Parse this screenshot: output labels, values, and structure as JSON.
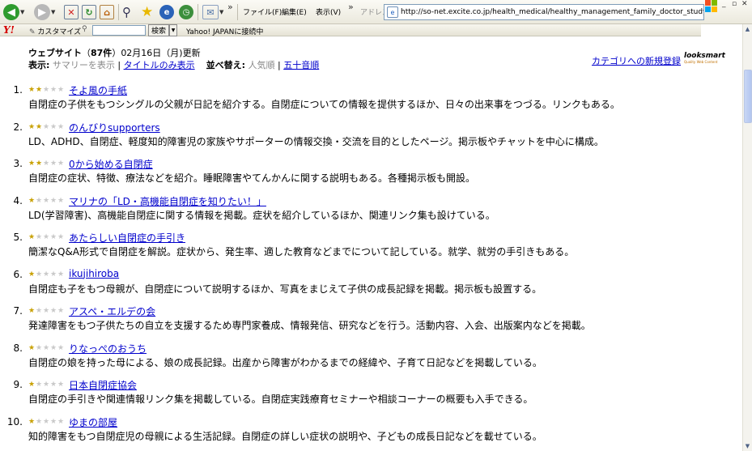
{
  "toolbar": {
    "menus": [
      "ファイル(F)",
      "編集(E)",
      "表示(V)"
    ],
    "address_label": "アドレス",
    "url": "http://so-net.excite.co.jp/health_medical/healthy_management_family_doctor_study/chik"
  },
  "yahoo_bar": {
    "logo": "Y!",
    "customize": "カスタマイズ",
    "search_button": "検索",
    "status": "Yahoo! JAPANに接続中"
  },
  "header": {
    "section": "ウェブサイト",
    "count": "87件",
    "updated": "02月16日（月)更新",
    "display_label": "表示:",
    "display_summary": "サマリーを表示",
    "display_title_only": "タイトルのみ表示",
    "sort_label": "並べ替え:",
    "sort_popular": "人気順",
    "sort_alpha": "五十音順",
    "new_category_link": "カテゴリへの新規登録",
    "logo_main": "looksmart",
    "logo_sub": "Quality Web Content"
  },
  "results": [
    {
      "num": "1.",
      "stars": 2,
      "title": "そよ風の手紙",
      "desc": "自閉症の子供をもつシングルの父親が日記を紹介する。自閉症についての情報を提供するほか、日々の出来事をつづる。リンクもある。"
    },
    {
      "num": "2.",
      "stars": 2,
      "title": "のんびりsupporters",
      "desc": "LD、ADHD、自閉症、軽度知的障害児の家族やサポーターの情報交換・交流を目的としたページ。掲示板やチャットを中心に構成。"
    },
    {
      "num": "3.",
      "stars": 2,
      "title": "0から始める自閉症",
      "desc": "自閉症の症状、特徴、療法などを紹介。睡眠障害やてんかんに関する説明もある。各種掲示板も開設。"
    },
    {
      "num": "4.",
      "stars": 1,
      "title": "マリナの「LD・高機能自閉症を知りたい！」",
      "desc": "LD(学習障害)、高機能自閉症に関する情報を掲載。症状を紹介しているほか、関連リンク集も設けている。"
    },
    {
      "num": "5.",
      "stars": 1,
      "title": "あたらしい自閉症の手引き",
      "desc": "簡潔なQ&A形式で自閉症を解説。症状から、発生率、適した教育などまでについて記している。就学、就労の手引きもある。"
    },
    {
      "num": "6.",
      "stars": 1,
      "title": "ikujihiroba",
      "desc": "自閉症も子をもつ母親が、自閉症について説明するほか、写真をまじえて子供の成長記録を掲載。掲示板も設置する。"
    },
    {
      "num": "7.",
      "stars": 1,
      "title": "アスペ・エルデの会",
      "desc": "発達障害をもつ子供たちの自立を支援するため専門家養成、情報発信、研究などを行う。活動内容、入会、出版案内などを掲載。"
    },
    {
      "num": "8.",
      "stars": 1,
      "title": "りなっぺのおうち",
      "desc": "自閉症の娘を持った母による、娘の成長記録。出産から障害がわかるまでの経緯や、子育て日記などを掲載している。"
    },
    {
      "num": "9.",
      "stars": 1,
      "title": "日本自閉症協会",
      "desc": "自閉症の手引きや関連情報リンク集を掲載している。自閉症実践療育セミナーや相談コーナーの概要も入手できる。"
    },
    {
      "num": "10.",
      "stars": 1,
      "title": "ゆまの部屋",
      "desc": "知的障害をもつ自閉症児の母親による生活記録。自閉症の詳しい症状の説明や、子どもの成長日記などを載せている。"
    }
  ],
  "colors": {
    "link": "#0000cc",
    "star_on": "#c8a000",
    "star_off": "#c9c9c9"
  }
}
